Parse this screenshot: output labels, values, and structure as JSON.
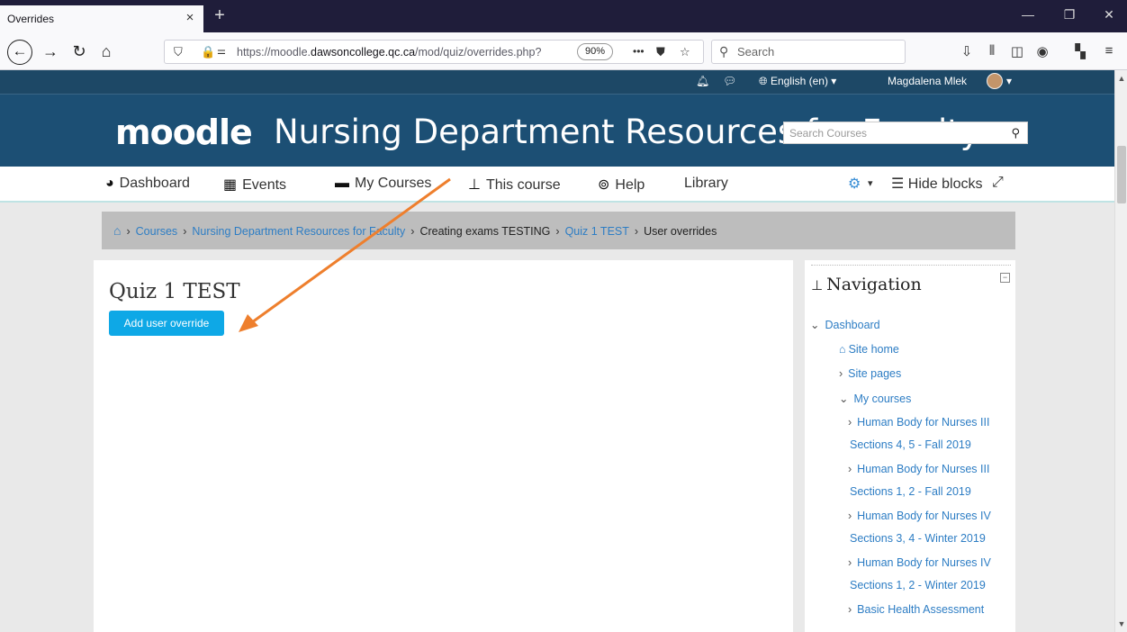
{
  "browser": {
    "tab_title": "Overrides",
    "tab_close": "×",
    "new_tab": "+",
    "url_prefix": "https://moodle.",
    "url_domain": "dawsoncollege.qc.ca",
    "url_path": "/mod/quiz/overrides.php?",
    "zoom": "90%",
    "page_actions": "•••",
    "search_placeholder": "Search",
    "window_controls": {
      "minimize": "—",
      "restore": "❐",
      "close": "✕"
    }
  },
  "topnav": {
    "language": "English (en) ▾",
    "user_name": "Magdalena Mlek",
    "user_menu_caret": "▾"
  },
  "header": {
    "logo_text": "moodle",
    "site_title": "Nursing Department Resources for Faculty",
    "search_placeholder": "Search Courses"
  },
  "menu": {
    "items": [
      {
        "label": "Dashboard",
        "icon": "tachometer-icon"
      },
      {
        "label": "Events",
        "icon": "calendar-icon"
      },
      {
        "label": "My Courses",
        "icon": "briefcase-icon"
      },
      {
        "label": "This course",
        "icon": "sitemap-icon"
      },
      {
        "label": "Help",
        "icon": "life-ring-icon"
      },
      {
        "label": "Library",
        "icon": ""
      }
    ],
    "settings_caret": "▾",
    "hide_blocks": "Hide blocks"
  },
  "breadcrumb": {
    "items": [
      {
        "label": "Courses",
        "link": true
      },
      {
        "label": "Nursing Department Resources for Faculty",
        "link": true
      },
      {
        "label": "Creating exams TESTING",
        "link": false
      },
      {
        "label": "Quiz 1 TEST",
        "link": true
      },
      {
        "label": "User overrides",
        "link": false
      }
    ],
    "separator": "›"
  },
  "main": {
    "heading": "Quiz 1 TEST",
    "add_button": "Add user override"
  },
  "navigation_block": {
    "title": "Navigation",
    "items": [
      {
        "label": "Dashboard",
        "arrow": "⌄"
      },
      {
        "label": "Site home",
        "arrow": ""
      },
      {
        "label": "Site pages",
        "arrow": "›"
      },
      {
        "label": "My courses",
        "arrow": "⌄"
      },
      {
        "label": "Human Body for Nurses III",
        "arrow": "›"
      },
      {
        "label": "Sections 4, 5 - Fall 2019",
        "arrow": ""
      },
      {
        "label": "Human Body for Nurses III",
        "arrow": "›"
      },
      {
        "label": "Sections 1, 2 - Fall 2019",
        "arrow": ""
      },
      {
        "label": "Human Body for Nurses IV",
        "arrow": "›"
      },
      {
        "label": "Sections 3, 4 - Winter 2019",
        "arrow": ""
      },
      {
        "label": "Human Body for Nurses IV",
        "arrow": "›"
      },
      {
        "label": "Sections 1, 2 - Winter 2019",
        "arrow": ""
      },
      {
        "label": "Basic Health Assessment",
        "arrow": "›"
      }
    ]
  },
  "colors": {
    "header_bg": "#1c4f74",
    "topnav_bg": "#1d4866",
    "link": "#2d7dc4",
    "button": "#0ea8e6",
    "annotation_arrow": "#ee7f2d"
  }
}
